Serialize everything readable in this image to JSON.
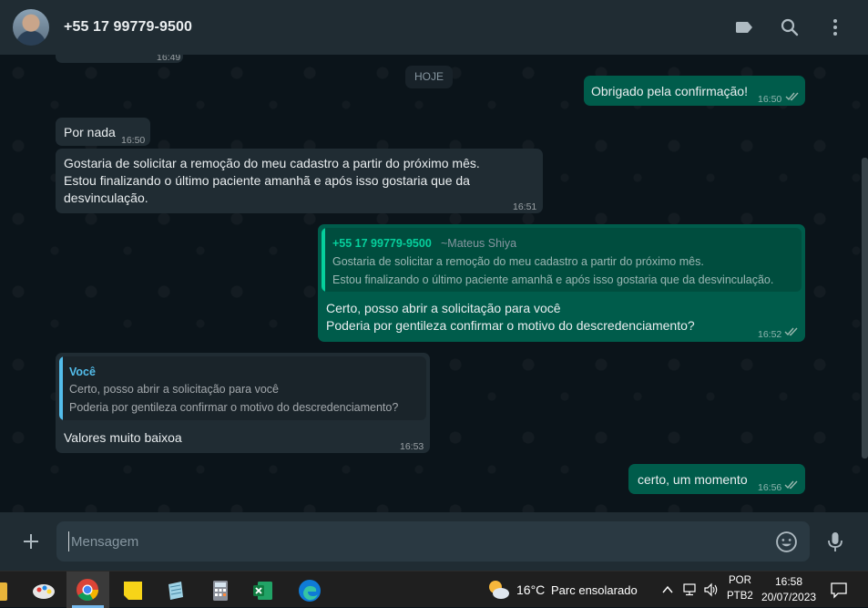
{
  "header": {
    "contact_name": "+55 17 99779-9500"
  },
  "chat": {
    "partial_time": "16:49",
    "date_divider": "HOJE",
    "messages": [
      {
        "direction": "out",
        "text": "Obrigado pela confirmação!",
        "time": "16:50",
        "status": "read"
      },
      {
        "direction": "in",
        "text": "Por nada",
        "time": "16:50"
      },
      {
        "direction": "in",
        "lines": [
          "Gostaria de solicitar a remoção do meu cadastro a partir do próximo mês.",
          "Estou finalizando o último paciente amanhã e após isso gostaria que da",
          "desvinculação."
        ],
        "time": "16:51"
      },
      {
        "direction": "out",
        "quote": {
          "author": "+55 17 99779-9500",
          "author_sub": "~Mateus Shiya",
          "lines": [
            "Gostaria de solicitar a remoção do meu cadastro a partir do próximo mês.",
            "Estou finalizando o último paciente amanhã e após isso gostaria que da desvinculação."
          ]
        },
        "lines": [
          "Certo, posso abrir a solicitação para você",
          "Poderia por gentileza confirmar o motivo do descredenciamento?"
        ],
        "time": "16:52",
        "status": "read"
      },
      {
        "direction": "in",
        "quote": {
          "author": "Você",
          "lines": [
            "Certo, posso abrir a solicitação para você",
            "Poderia por gentileza confirmar o motivo do descredenciamento?"
          ]
        },
        "text": "Valores muito baixoa",
        "time": "16:53"
      },
      {
        "direction": "out",
        "text": "certo, um momento",
        "time": "16:56",
        "status": "read"
      }
    ]
  },
  "composer": {
    "placeholder": "Mensagem"
  },
  "taskbar": {
    "weather": {
      "temp": "16°C",
      "condition": "Parc ensolarado"
    },
    "language": "POR",
    "layout": "PTB2",
    "clock_time": "16:58",
    "clock_date": "20/07/2023"
  },
  "colors": {
    "incoming_bubble": "#202c33",
    "outgoing_bubble": "#005c4b",
    "read_ticks": "#53bdeb",
    "quote_self": "#53bdeb",
    "quote_contact": "#06cf9c"
  }
}
